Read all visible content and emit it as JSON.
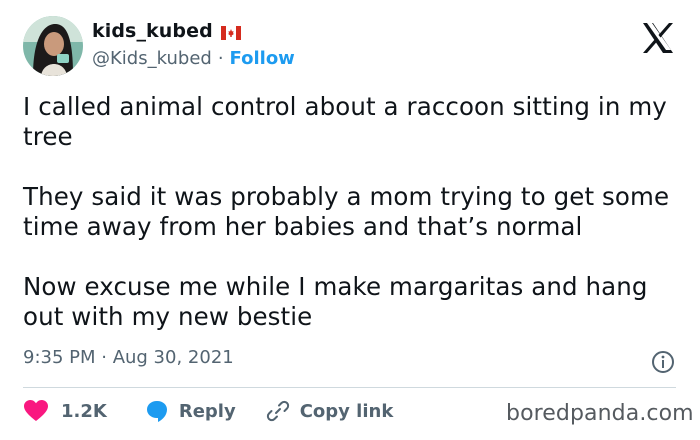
{
  "author": {
    "display_name": "kids_kubed",
    "flag_icon": "canada-flag-icon",
    "handle": "@Kids_kubed",
    "separator": "·",
    "follow_label": "Follow"
  },
  "platform_icon": "x-logo-icon",
  "tweet": {
    "paragraphs": [
      "I called animal control about a raccoon sitting in my tree",
      "They said it was probably a mom trying to get some time away from her babies and that’s normal",
      "Now excuse me while I make margaritas and hang out with my new bestie"
    ]
  },
  "meta": {
    "timestamp": "9:35 PM · Aug 30, 2021",
    "info_icon": "info-icon"
  },
  "actions": {
    "like_count": "1.2K",
    "reply_label": "Reply",
    "copy_link_label": "Copy link"
  },
  "watermark": "boredpanda.com",
  "colors": {
    "text": "#0f1419",
    "secondary": "#536471",
    "accent": "#1d9bf0",
    "like": "#f91880",
    "divider": "#cfd9de"
  }
}
